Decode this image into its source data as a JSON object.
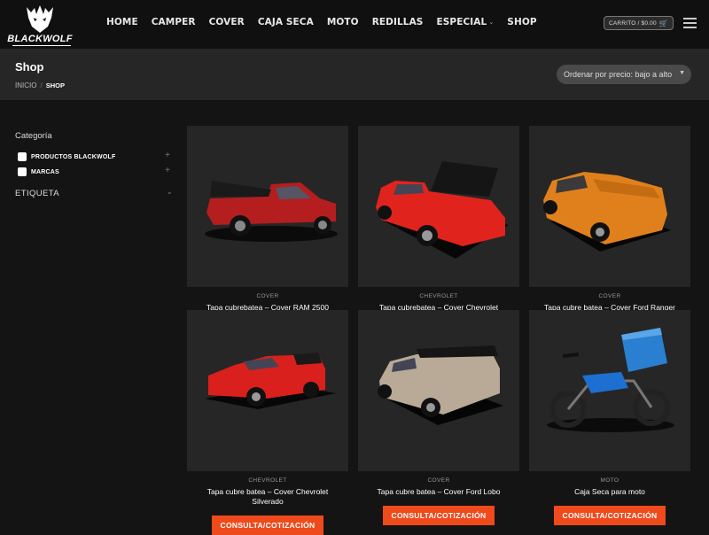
{
  "header": {
    "logo_text": "BLACKWOLF",
    "nav": [
      {
        "label": "HOME"
      },
      {
        "label": "CAMPER"
      },
      {
        "label": "COVER"
      },
      {
        "label": "CAJA SECA"
      },
      {
        "label": "MOTO"
      },
      {
        "label": "REDILLAS"
      },
      {
        "label": "ESPECIAL",
        "has_dropdown": true
      },
      {
        "label": "SHOP"
      }
    ],
    "cart_label": "CARRITO / $0.00",
    "cart_icon": "cart-icon",
    "menu_icon": "hamburger-icon"
  },
  "title_bar": {
    "title": "Shop",
    "breadcrumb": {
      "home": "INICIO",
      "separator": "/",
      "current": "SHOP"
    },
    "sort": {
      "selected": "Ordenar por precio: bajo a alto"
    }
  },
  "sidebar": {
    "category_title": "Categoría",
    "categories": [
      {
        "label": "PRODUCTOS BLACKWOLF",
        "checked": false
      },
      {
        "label": "MARCAS",
        "checked": false
      }
    ],
    "tag_title": "ETIQUETA"
  },
  "products": [
    {
      "category": "COVER",
      "name": "Tapa cubrebatea – Cover RAM 2500",
      "image": "red-ram-truck"
    },
    {
      "category": "CHEVROLET",
      "name": "Tapa cubrebatea – Cover Chevrolet",
      "image": "red-chevrolet-truck"
    },
    {
      "category": "COVER",
      "name": "Tapa cubre batea – Cover Ford Ranger",
      "image": "orange-ranger-truck"
    },
    {
      "category": "CHEVROLET",
      "name": "Tapa cubre batea – Cover Chevrolet Silverado",
      "image": "red-silverado-truck",
      "button": "CONSULTA/COTIZACIÓN"
    },
    {
      "category": "COVER",
      "name": "Tapa cubre batea – Cover Ford Lobo",
      "image": "beige-lobo-truck",
      "button": "CONSULTA/COTIZACIÓN"
    },
    {
      "category": "MOTO",
      "name": "Caja Seca para moto",
      "image": "blue-motorcycle",
      "button": "CONSULTA/COTIZACIÓN"
    }
  ],
  "colors": {
    "accent": "#ee4a1c",
    "header_bg": "#101010",
    "title_bar_bg": "#262626",
    "card_bg": "#262626"
  }
}
